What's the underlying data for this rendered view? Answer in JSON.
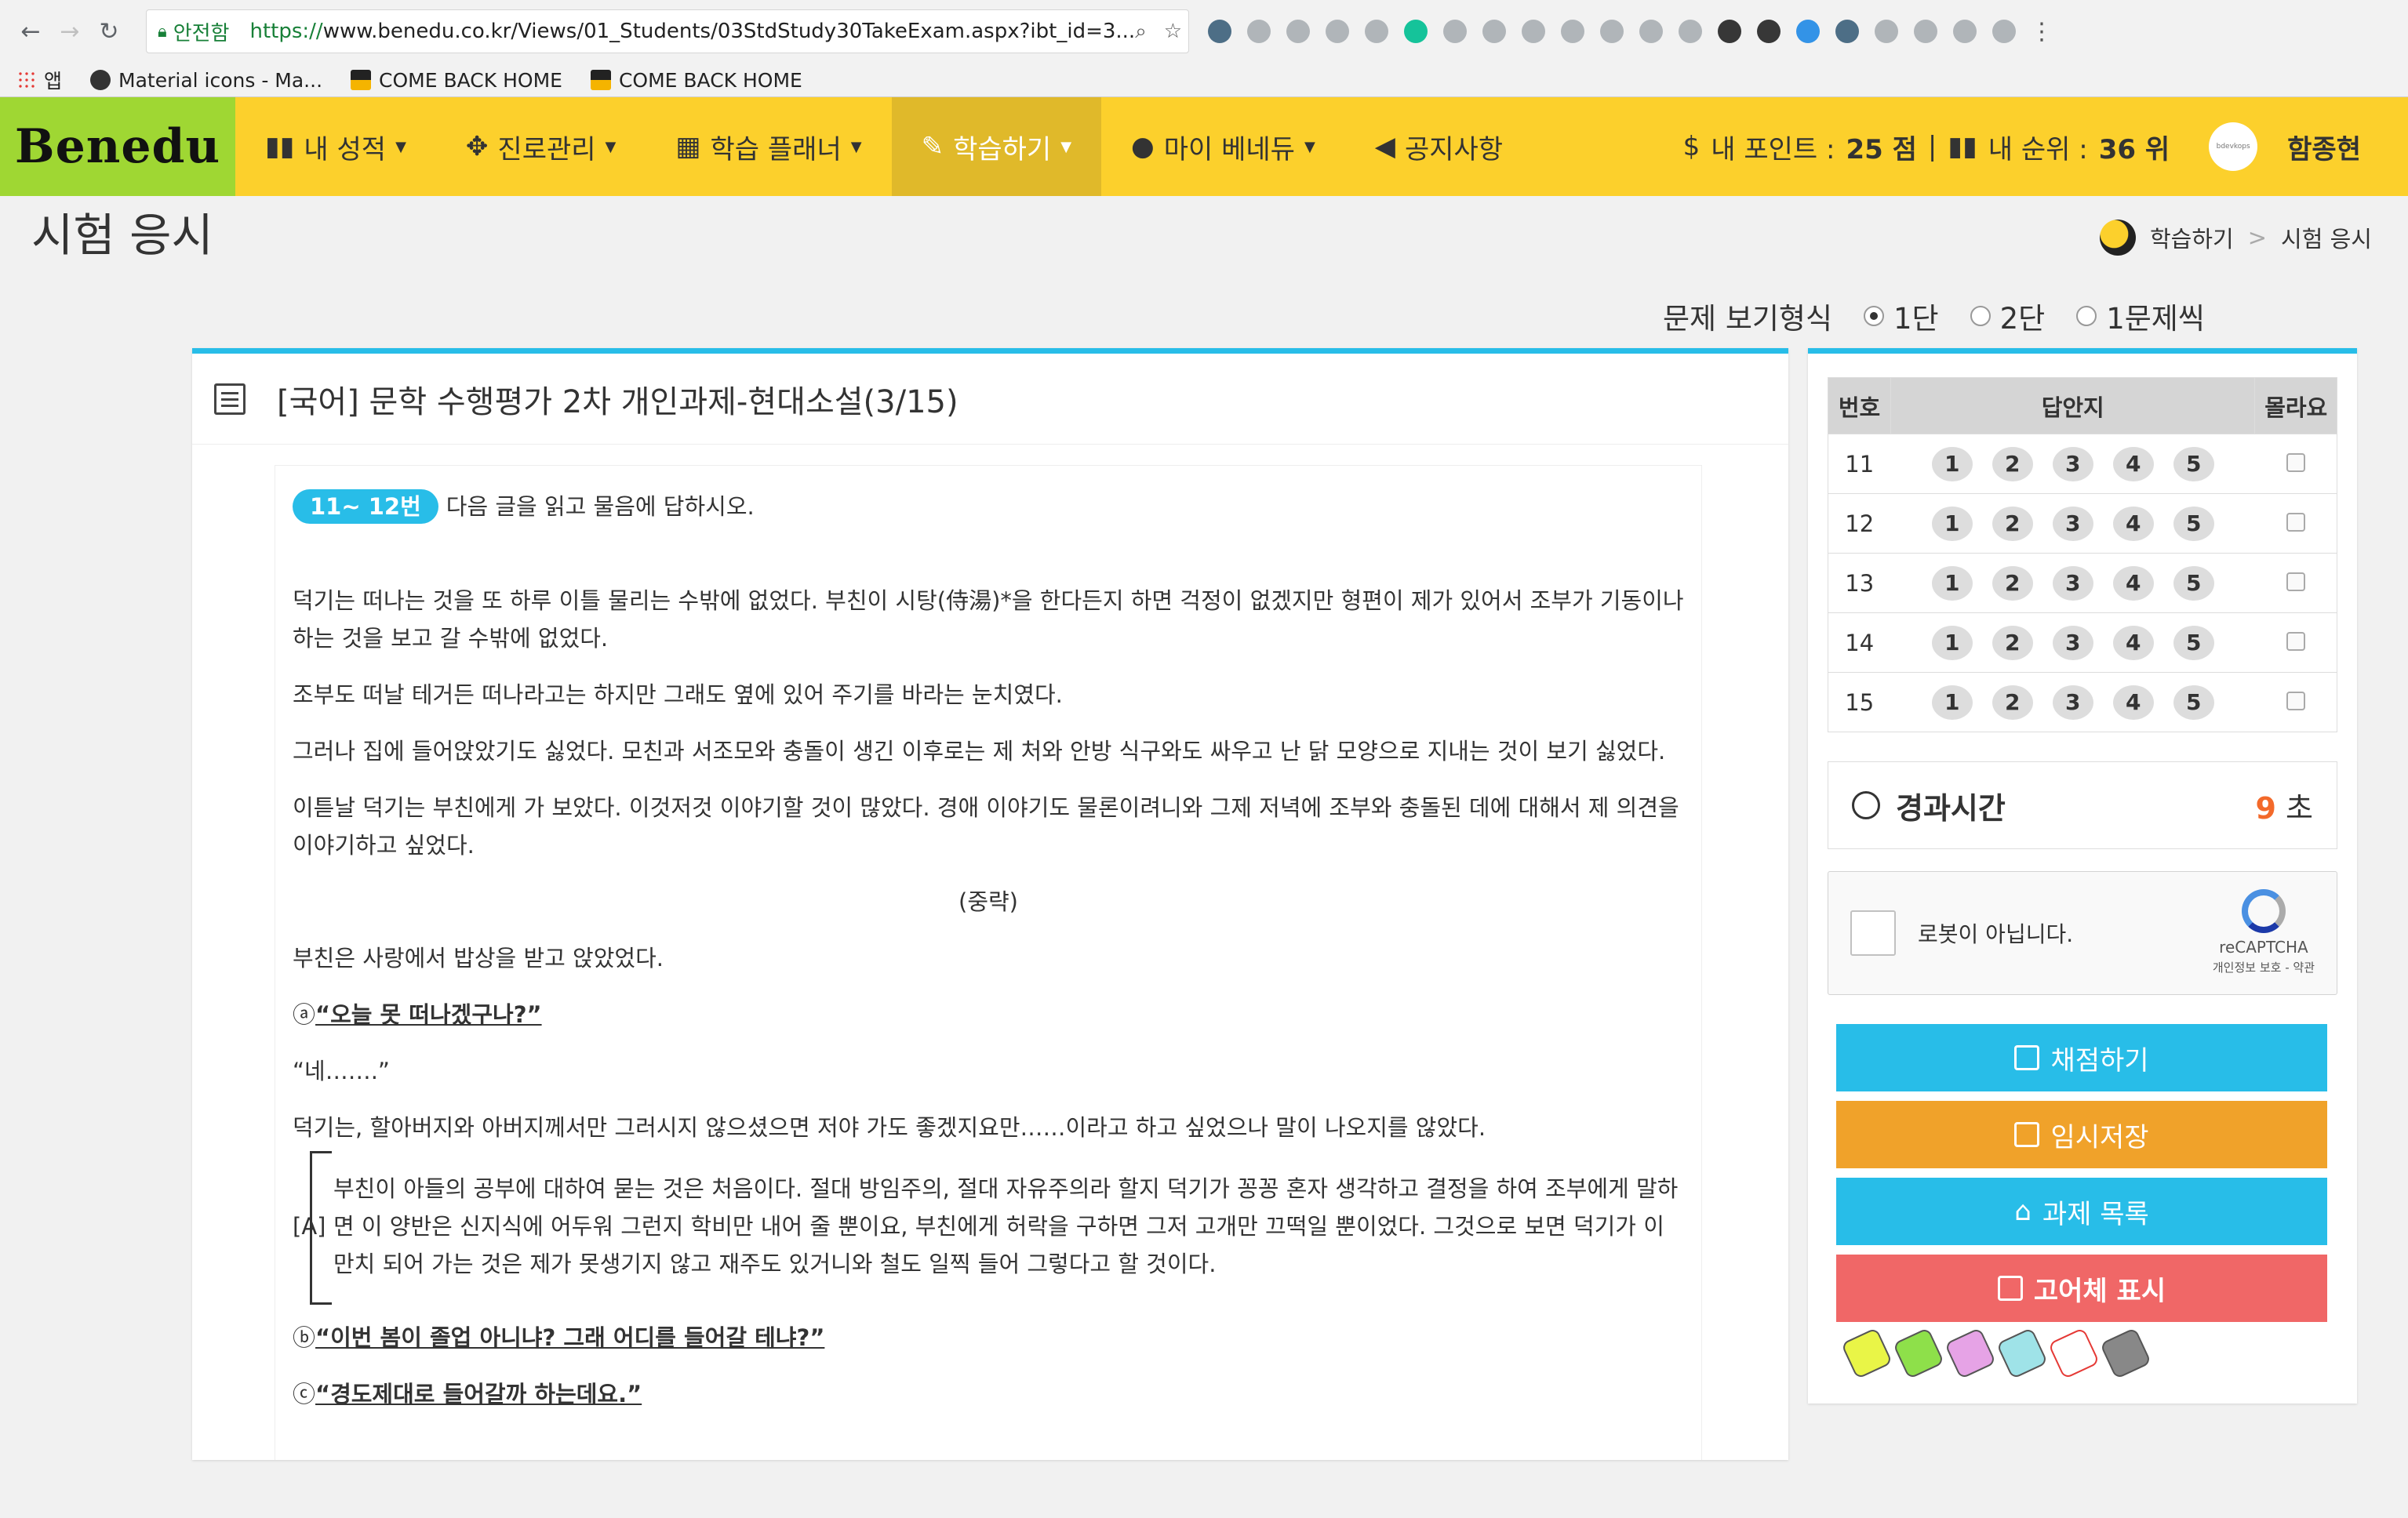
{
  "browser": {
    "secure_label": "안전함",
    "url_https": "https://",
    "url_rest": "www.benedu.co.kr/Views/01_Students/03StdStudy30TakeExam.aspx?ibt_id=3...",
    "bookmarks": [
      {
        "label": "앱"
      },
      {
        "label": "Material icons - Ma..."
      },
      {
        "label": "COME BACK HOME"
      },
      {
        "label": "COME BACK HOME"
      }
    ]
  },
  "nav": {
    "logo": "Benedu",
    "menu": [
      "내 성적",
      "진로관리",
      "학습 플래너",
      "학습하기",
      "마이 베네듀",
      "공지사항"
    ],
    "points_label": "내 포인트 :",
    "points_value": "25 점",
    "rank_label": "내 순위 :",
    "rank_value": "36 위",
    "avatar_text": "bdevkops",
    "username": "함종현"
  },
  "page": {
    "title": "시험 응시",
    "breadcrumb": [
      "학습하기",
      "시험 응시"
    ],
    "view_mode_label": "문제 보기형식",
    "view_options": [
      "1단",
      "2단",
      "1문제씩"
    ]
  },
  "exam": {
    "title": "[국어] 문학 수행평가 2차 개인과제-현대소설(3/15)",
    "question_range": "11~ 12번",
    "instruction": "다음 글을 읽고 물음에 답하시오.",
    "paragraphs": [
      "덕기는 떠나는 것을 또 하루 이틀 물리는 수밖에 없었다. 부친이 시탕(侍湯)*을 한다든지 하면 걱정이 없겠지만 형편이 제가 있어서 조부가 기동이나 하는 것을 보고 갈 수밖에 없었다.",
      "조부도 떠날 테거든 떠나라고는 하지만 그래도 옆에 있어 주기를 바라는 눈치였다.",
      "그러나 집에 들어앉았기도 싫었다. 모친과 서조모와 충돌이 생긴 이후로는 제 처와 안방 식구와도 싸우고 난 닭 모양으로 지내는 것이 보기 싫었다.",
      "이튿날 덕기는 부친에게 가 보았다. 이것저것 이야기할 것이 많았다. 경애 이야기도 물론이려니와 그제 저녁에 조부와 충돌된 데에 대해서 제 의견을 이야기하고 싶었다."
    ],
    "omitted": "(중략)",
    "para_after": "부친은 사랑에서 밥상을 받고 앉았었다.",
    "marker_a": "ⓐ",
    "quote_a": "“오늘 못 떠나겠구나?”",
    "reply": "“네…….”",
    "para_thought": "덕기는, 할아버지와 아버지께서만 그러시지 않으셨으면 저야 가도 좋겠지요만……이라고 하고 싶었으나 말이 나오지를 않았다.",
    "bracket_label": "[A]",
    "bracket_text": "부친이 아들의 공부에 대하여 묻는 것은 처음이다. 절대 방임주의, 절대 자유주의라 할지 덕기가 꽁꽁 혼자 생각하고 결정을 하여 조부에게 말하면 이 양반은 신지식에 어두워 그런지 학비만 내어 줄 뿐이요, 부친에게 허락을 구하면 그저 고개만 끄떡일 뿐이었다. 그것으로 보면 덕기가 이만치 되어 가는 것은 제가 못생기지 않고 재주도 있거니와 철도 일찍 들어 그렇다고 할 것이다.",
    "marker_b": "ⓑ",
    "quote_b": "“이번 봄이 졸업 아니냐? 그래 어디를 들어갈 테냐?”",
    "marker_c": "ⓒ",
    "quote_c": "“경도제대로 들어갈까 하는데요.”"
  },
  "answer_sheet": {
    "headers": [
      "번호",
      "답안지",
      "몰라요"
    ],
    "rows": [
      {
        "no": "11"
      },
      {
        "no": "12"
      },
      {
        "no": "13"
      },
      {
        "no": "14"
      },
      {
        "no": "15"
      }
    ],
    "choices": [
      "1",
      "2",
      "3",
      "4",
      "5"
    ]
  },
  "timer": {
    "label": "경과시간",
    "value": "9",
    "unit": "초"
  },
  "captcha": {
    "label": "로봇이 아닙니다.",
    "brand": "reCAPTCHA",
    "privacy": "개인정보 보호 - 약관"
  },
  "actions": [
    "채점하기",
    "임시저장",
    "과제 목록",
    "고어체 표시"
  ],
  "colors": {
    "nav_bg": "#fcd02c",
    "logo_bg": "#9fd733",
    "accent": "#28bde8",
    "save": "#f0a22a",
    "danger": "#f06767",
    "timer": "#f3692a"
  }
}
